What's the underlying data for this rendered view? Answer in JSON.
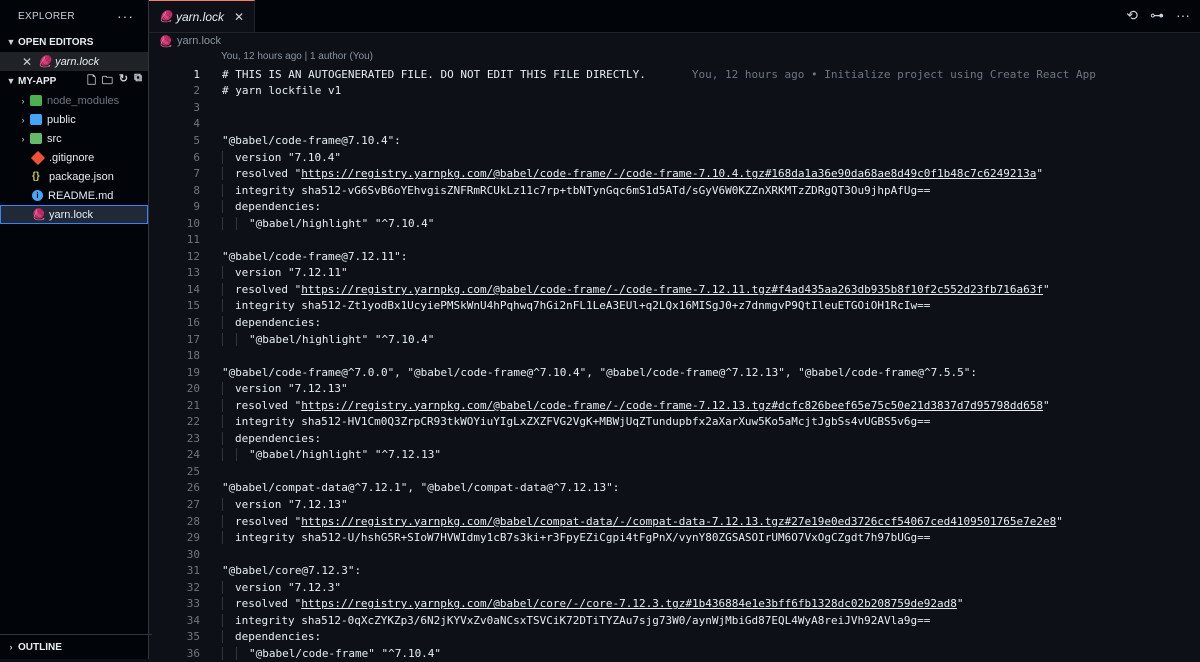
{
  "sidebar": {
    "title": "EXPLORER",
    "more_glyph": "···",
    "open_editors_label": "OPEN EDITORS",
    "open_editor_file": "yarn.lock",
    "project_label": "MY-APP",
    "items": [
      {
        "label": "node_modules",
        "kind": "folder"
      },
      {
        "label": "public",
        "kind": "folder"
      },
      {
        "label": "src",
        "kind": "folder"
      },
      {
        "label": ".gitignore",
        "kind": "file"
      },
      {
        "label": "package.json",
        "kind": "file"
      },
      {
        "label": "README.md",
        "kind": "file"
      },
      {
        "label": "yarn.lock",
        "kind": "file"
      }
    ],
    "outline_label": "OUTLINE"
  },
  "tab": {
    "label": "yarn.lock"
  },
  "breadcrumb": {
    "label": "yarn.lock"
  },
  "codelens": "You, 12 hours ago | 1 author (You)",
  "blame": "You, 12 hours ago • Initialize project using Create React App",
  "code": [
    "# THIS IS AN AUTOGENERATED FILE. DO NOT EDIT THIS FILE DIRECTLY.",
    "# yarn lockfile v1",
    "",
    "",
    "\"@babel/code-frame@7.10.4\":",
    "version \"7.10.4\"",
    "resolved \"https://registry.yarnpkg.com/@babel/code-frame/-/code-frame-7.10.4.tgz#168da1a36e90da68ae8d49c0f1b48c7c6249213a\"",
    "integrity sha512-vG6SvB6oYEhvgisZNFRmRCUkLz11c7rp+tbNTynGqc6mS1d5ATd/sGyV6W0KZZnXRKMTzZDRgQT3Ou9jhpAfUg==",
    "dependencies:",
    "\"@babel/highlight\" \"^7.10.4\"",
    "",
    "\"@babel/code-frame@7.12.11\":",
    "version \"7.12.11\"",
    "resolved \"https://registry.yarnpkg.com/@babel/code-frame/-/code-frame-7.12.11.tgz#f4ad435aa263db935b8f10f2c552d23fb716a63f\"",
    "integrity sha512-Zt1yodBx1UcyiePMSkWnU4hPqhwq7hGi2nFL1LeA3EUl+q2LQx16MISgJ0+z7dnmgvP9QtIleuETGOiOH1RcIw==",
    "dependencies:",
    "\"@babel/highlight\" \"^7.10.4\"",
    "",
    "\"@babel/code-frame@^7.0.0\", \"@babel/code-frame@^7.10.4\", \"@babel/code-frame@^7.12.13\", \"@babel/code-frame@^7.5.5\":",
    "version \"7.12.13\"",
    "resolved \"https://registry.yarnpkg.com/@babel/code-frame/-/code-frame-7.12.13.tgz#dcfc826beef65e75c50e21d3837d7d95798dd658\"",
    "integrity sha512-HV1Cm0Q3ZrpCR93tkWOYiuYIgLxZXZFVG2VgK+MBWjUqZTundupbfx2aXarXuw5Ko5aMcjtJgbSs4vUGBS5v6g==",
    "dependencies:",
    "\"@babel/highlight\" \"^7.12.13\"",
    "",
    "\"@babel/compat-data@^7.12.1\", \"@babel/compat-data@^7.12.13\":",
    "version \"7.12.13\"",
    "resolved \"https://registry.yarnpkg.com/@babel/compat-data/-/compat-data-7.12.13.tgz#27e19e0ed3726ccf54067ced4109501765e7e2e8\"",
    "integrity sha512-U/hshG5R+SIoW7HVWIdmy1cB7s3ki+r3FpyEZiCgpi4tFgPnX/vynY80ZGSASOIrUM6O7VxOgCZgdt7h97bUGg==",
    "",
    "\"@babel/core@7.12.3\":",
    "version \"7.12.3\"",
    "resolved \"https://registry.yarnpkg.com/@babel/core/-/core-7.12.3.tgz#1b436884e1e3bff6fb1328dc02b208759de92ad8\"",
    "integrity sha512-0qXcZYKZp3/6N2jKYVxZv0aNCsxTSVCiK72DTiTYZAu7sjg73W0/aynWjMbiGd87EQL4WyA8reiJVh92AVla9g==",
    "dependencies:",
    "\"@babel/code-frame\" \"^7.10.4\""
  ]
}
